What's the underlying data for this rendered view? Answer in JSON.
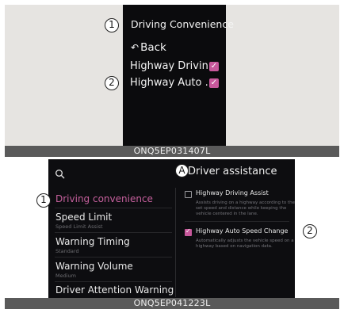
{
  "top_panel": {
    "callouts": [
      "1",
      "2"
    ],
    "title": "Driving Convenience",
    "back_icon": "return-arrow-icon",
    "back_label": "Back",
    "items": [
      {
        "label": "Highway Drivin...",
        "checked": true
      },
      {
        "label": "Highway Auto ...",
        "checked": true
      }
    ],
    "caption": "ONQ5EP031407L"
  },
  "bottom_panel": {
    "callouts": [
      "1",
      "A",
      "2"
    ],
    "search_icon": "search-icon",
    "menu": [
      {
        "label": "Driving convenience",
        "sub": "",
        "active": true
      },
      {
        "label": "Speed Limit",
        "sub": "Speed Limit Assist",
        "active": false
      },
      {
        "label": "Warning Timing",
        "sub": "Standard",
        "active": false
      },
      {
        "label": "Warning Volume",
        "sub": "Medium",
        "active": false
      },
      {
        "label": "Driver Attention Warning",
        "sub": "",
        "active": false
      }
    ],
    "section_title": "Driver assistance",
    "options": [
      {
        "label": "Highway Driving Assist",
        "checked": false,
        "description": "Assists driving on a highway according to the set speed and distance while keeping the vehicle centered in the lane."
      },
      {
        "label": "Highway Auto Speed Change",
        "checked": true,
        "description": "Automatically adjusts the vehicle speed on a highway based on navigation data."
      }
    ],
    "caption": "ONQ5EP041223L"
  },
  "colors": {
    "accent": "#c7589b",
    "screen_bg": "#0b0b0d",
    "caption_bar": "#5a5a5a"
  }
}
